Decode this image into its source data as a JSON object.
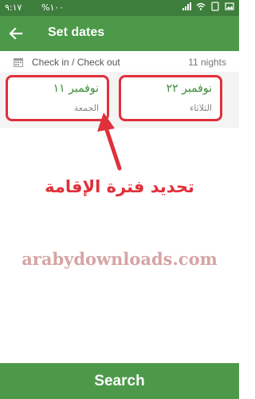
{
  "status_bar": {
    "time": "٩:١٧",
    "battery": "%١٠٠",
    "icons": [
      "signal-icon",
      "wifi-icon",
      "notification-icon",
      "gallery-icon"
    ]
  },
  "app_bar": {
    "title": "Set dates",
    "back_icon": "back-arrow-icon"
  },
  "range": {
    "label": "Check in / Check out",
    "nights": "11 nights",
    "icon": "calendar-icon"
  },
  "dates": {
    "checkin": {
      "date": "نوفمبر ١١",
      "weekday": "الجمعة"
    },
    "checkout": {
      "date": "نوفمبر ٢٢",
      "weekday": "الثلاثاء"
    }
  },
  "annotation": {
    "text": "تحديد فترة الإقامة",
    "color": "#e0303a"
  },
  "watermark": "arabydownloads.com",
  "search_button": "Search",
  "colors": {
    "primary": "#4c994a",
    "status_bar": "#3e7e3c",
    "date_text": "#3c8a3a",
    "highlight": "#e0303a"
  }
}
